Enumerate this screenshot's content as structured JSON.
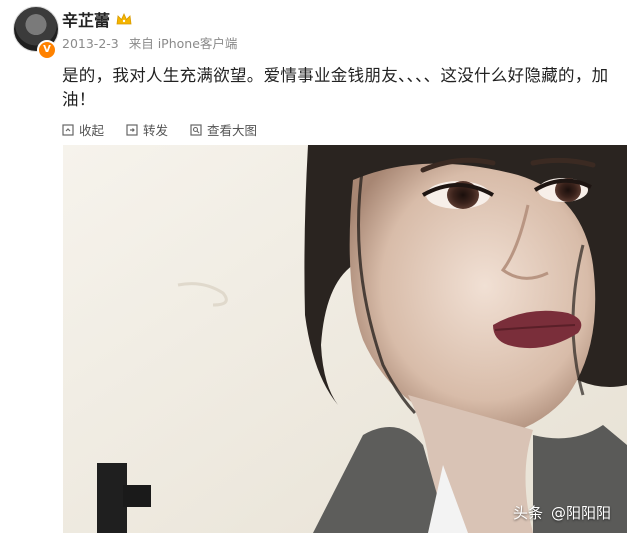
{
  "user": {
    "name": "辛芷蕾",
    "verified_badge": "V"
  },
  "post": {
    "date": "2013-2-3",
    "source": "来自 iPhone客户端",
    "text": "是的，我对人生充满欲望。爱情事业金钱朋友、、、、这没什么好隐藏的，加油！"
  },
  "toolbar": {
    "collapse_label": "收起",
    "repost_label": "转发",
    "view_large_label": "查看大图"
  },
  "watermark": {
    "platform": "头条",
    "author": "@阳阳阳"
  },
  "icons": [
    "crown-icon",
    "collapse-icon",
    "repost-icon",
    "zoom-icon"
  ],
  "colors": {
    "badge": "#ff8200",
    "meta": "#8a8a8a"
  }
}
